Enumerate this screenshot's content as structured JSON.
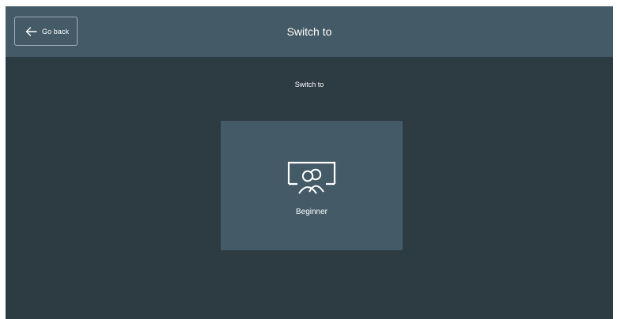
{
  "header": {
    "back_label": "Go back",
    "back_icon": "arrow-left-icon",
    "title": "Switch to"
  },
  "main": {
    "subtitle": "Switch to",
    "options": [
      {
        "label": "Beginner",
        "icon": "group-presentation-icon"
      }
    ]
  },
  "colors": {
    "header_bg": "#445a66",
    "body_bg": "#2d3b43",
    "card_bg": "#445a66",
    "text": "#ffffff"
  }
}
